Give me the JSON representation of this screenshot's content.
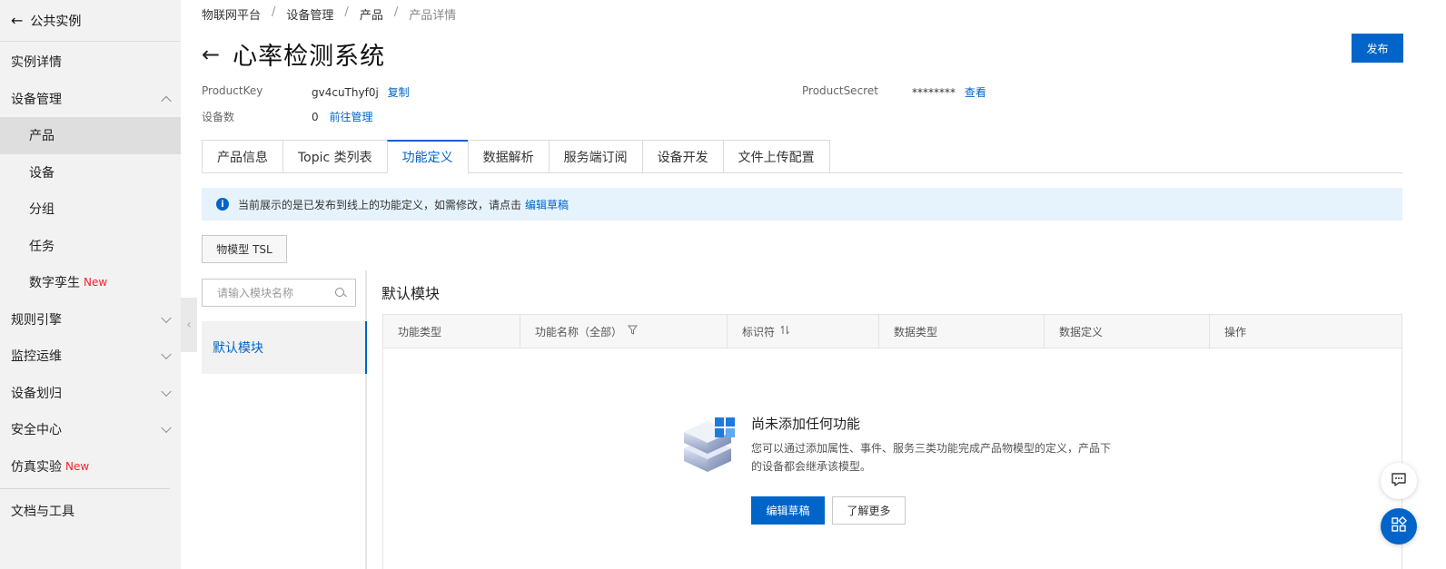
{
  "sidebar": {
    "back_label": "公共实例",
    "items": [
      {
        "label": "实例详情"
      },
      {
        "label": "设备管理"
      },
      {
        "label": "产品"
      },
      {
        "label": "设备"
      },
      {
        "label": "分组"
      },
      {
        "label": "任务"
      },
      {
        "label": "数字孪生",
        "badge": "New"
      },
      {
        "label": "规则引擎"
      },
      {
        "label": "监控运维"
      },
      {
        "label": "设备划归"
      },
      {
        "label": "安全中心"
      },
      {
        "label": "仿真实验",
        "badge": "New"
      },
      {
        "label": "文档与工具"
      }
    ]
  },
  "breadcrumb": [
    "物联网平台",
    "设备管理",
    "产品",
    "产品详情"
  ],
  "breadcrumb_sep": "/",
  "header": {
    "title": "心率检测系统",
    "publish_label": "发布"
  },
  "meta": {
    "product_key_label": "ProductKey",
    "product_key_value": "gv4cuThyf0j",
    "copy_label": "复制",
    "product_secret_label": "ProductSecret",
    "product_secret_value": "********",
    "view_label": "查看",
    "device_count_label": "设备数",
    "device_count_value": "0",
    "manage_label": "前往管理"
  },
  "tabs": [
    {
      "label": "产品信息"
    },
    {
      "label": "Topic 类列表"
    },
    {
      "label": "功能定义",
      "active": true
    },
    {
      "label": "数据解析"
    },
    {
      "label": "服务端订阅"
    },
    {
      "label": "设备开发"
    },
    {
      "label": "文件上传配置"
    }
  ],
  "notice": {
    "text": "当前展示的是已发布到线上的功能定义，如需修改，请点击",
    "link": "编辑草稿"
  },
  "tsl_button": "物模型 TSL",
  "search": {
    "placeholder": "请输入模块名称"
  },
  "module": {
    "item": "默认模块",
    "section_title": "默认模块"
  },
  "table": {
    "columns": [
      "功能类型",
      "功能名称（全部）",
      "标识符",
      "数据类型",
      "数据定义",
      "操作"
    ]
  },
  "empty": {
    "title": "尚未添加任何功能",
    "desc": "您可以通过添加属性、事件、服务三类功能完成产品物模型的定义，产品下的设备都会继承该模型。",
    "primary_btn": "编辑草稿",
    "secondary_btn": "了解更多"
  },
  "colors": {
    "accent": "#0064c8",
    "new_badge": "#e8262c",
    "notice_bg": "#e6f3fc"
  },
  "icons": [
    "back-arrow-icon",
    "chevron-up-icon",
    "chevron-down-icon",
    "info-icon",
    "search-icon",
    "filter-icon",
    "sort-icon",
    "chat-icon",
    "apps-icon"
  ]
}
